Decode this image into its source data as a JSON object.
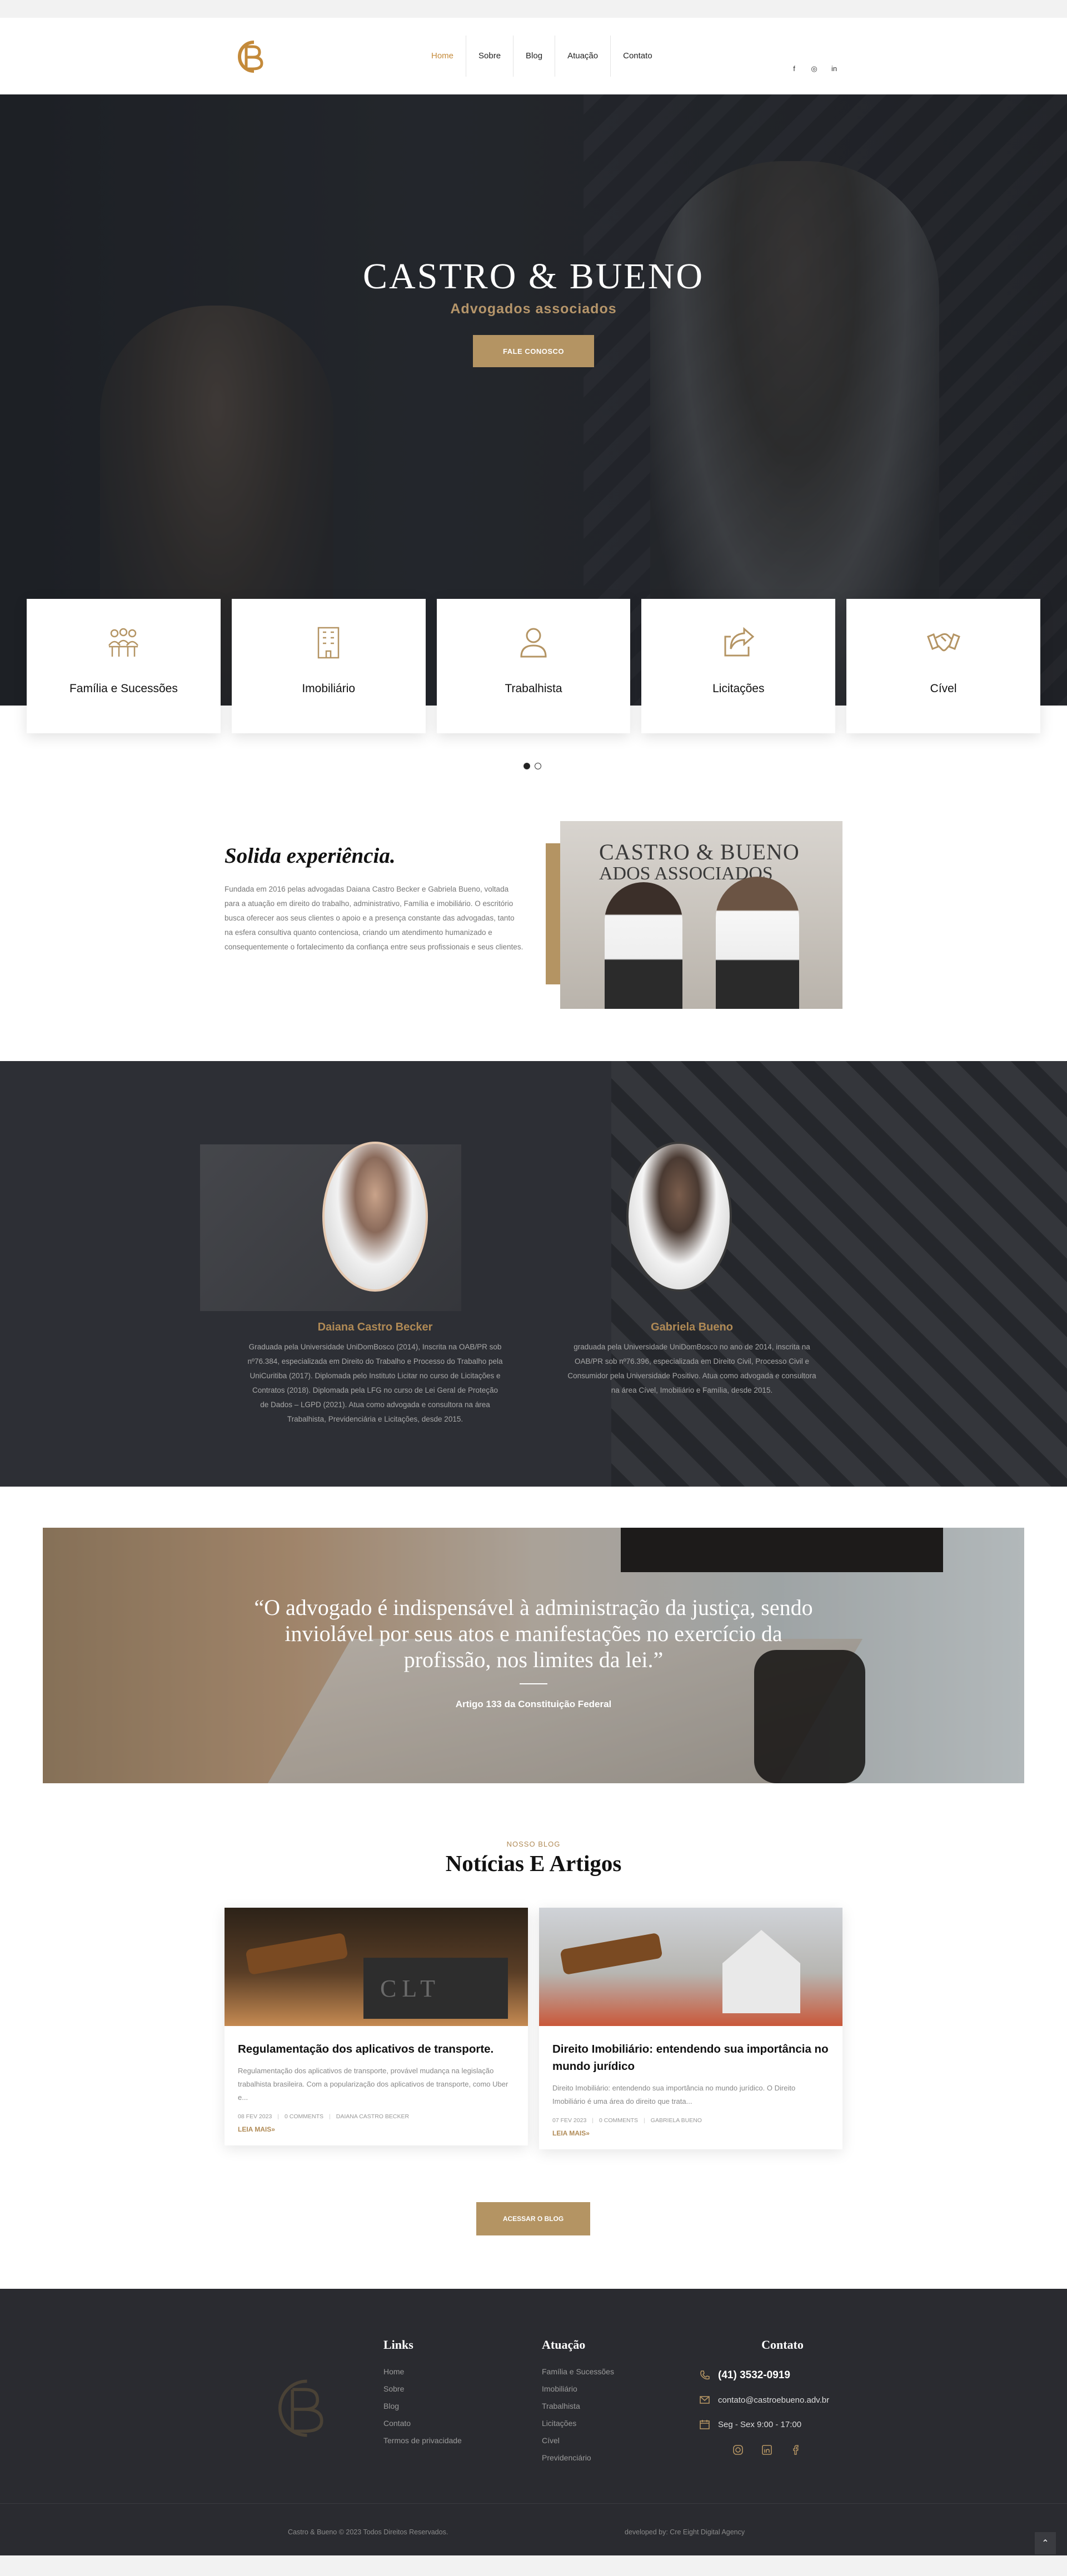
{
  "nav": {
    "items": [
      {
        "label": "Home"
      },
      {
        "label": "Sobre"
      },
      {
        "label": "Blog"
      },
      {
        "label": "Atuação"
      },
      {
        "label": "Contato"
      }
    ],
    "social": [
      "f",
      "◎",
      "in"
    ]
  },
  "hero": {
    "title": "CASTRO & BUENO",
    "subtitle": "Advogados associados",
    "cta": "FALE CONOSCO"
  },
  "services": [
    {
      "label": "Família e Sucessões",
      "icon": "family-icon"
    },
    {
      "label": "Imobiliário",
      "icon": "building-icon"
    },
    {
      "label": "Trabalhista",
      "icon": "user-icon"
    },
    {
      "label": "Licitações",
      "icon": "share-icon"
    },
    {
      "label": "Cível",
      "icon": "handshake-icon"
    }
  ],
  "experience": {
    "title": "Solida experiência.",
    "text": "Fundada em 2016 pelas advogadas Daiana Castro Becker e Gabriela Bueno, voltada para a atuação em direito do trabalho, administrativo, Família e imobiliário. O escritório busca oferecer aos seus clientes o apoio e a presença constante das advogadas, tanto na esfera consultiva quanto contenciosa, criando um atendimento humanizado e consequentemente o fortalecimento da confiança entre seus profissionais e seus clientes.",
    "sign_line1": "CASTRO & BUENO",
    "sign_line2": "ADOS ASSOCIADOS"
  },
  "team": [
    {
      "name": "Daiana Castro Becker",
      "bio": "Graduada pela Universidade UniDomBosco (2014), Inscrita na OAB/PR sob nº76.384, especializada em Direito do Trabalho e Processo do Trabalho pela UniCuritiba (2017). Diplomada pelo Instituto Licitar no curso de Licitações e Contratos (2018). Diplomada pela LFG no curso de Lei Geral de Proteção de Dados – LGPD (2021). Atua como advogada e consultora na área Trabalhista, Previdenciária e Licitações, desde 2015."
    },
    {
      "name": "Gabriela Bueno",
      "bio": "graduada pela Universidade UniDomBosco no ano de 2014, inscrita na OAB/PR sob nº76.396, especializada em Direito Civil, Processo Civil e Consumidor pela Universidade Positivo. Atua como advogada e consultora na área Cível, Imobiliário e Família, desde 2015."
    }
  ],
  "quote": {
    "text": "“O advogado é indispensável à administração da justiça, sendo inviolável por seus atos e manifestações no exercício da profissão, nos limites da lei.”",
    "author": "Artigo 133 da Constituição Federal"
  },
  "blog": {
    "kicker": "NOSSO BLOG",
    "title": "Notícias E Artigos",
    "posts": [
      {
        "title": "Regulamentação dos aplicativos de transporte.",
        "excerpt": "Regulamentação dos aplicativos de transporte, provável mudança na legislação trabalhista brasileira. Com a popularização dos aplicativos de transporte, como Uber e...",
        "date": "08 FEV 2023",
        "comments": "0 COMMENTS",
        "author": "DAIANA CASTRO BECKER",
        "more": "LEIA MAIS»",
        "image_text": "CLT"
      },
      {
        "title": "Direito Imobiliário: entendendo sua importância no mundo jurídico",
        "excerpt": "Direito Imobiliário: entendendo sua importância no mundo jurídico. O Direito Imobiliário é uma área do direito que trata...",
        "date": "07 FEV 2023",
        "comments": "0 COMMENTS",
        "author": "GABRIELA BUENO",
        "more": "LEIA MAIS»"
      }
    ],
    "button": "ACESSAR O BLOG"
  },
  "footer": {
    "links_title": "Links",
    "links": [
      "Home",
      "Sobre",
      "Blog",
      "Contato",
      "Termos de privacidade"
    ],
    "atuacao_title": "Atuação",
    "atuacao": [
      "Família e Sucessões",
      "Imobiliário",
      "Trabalhista",
      "Licitações",
      "Cível",
      "Previdenciário"
    ],
    "contact_title": "Contato",
    "phone": "(41) 3532-0919",
    "email": "contato@castroebueno.adv.br",
    "hours": "Seg - Sex 9:00 - 17:00",
    "copyright": "Castro & Bueno © 2023 Todos Direitos Reservados.",
    "developer": "developed by: Cre Eight Digital Agency"
  },
  "colors": {
    "gold": "#b49463",
    "gold_text": "#c48a3a",
    "dark": "#2a2b30"
  }
}
